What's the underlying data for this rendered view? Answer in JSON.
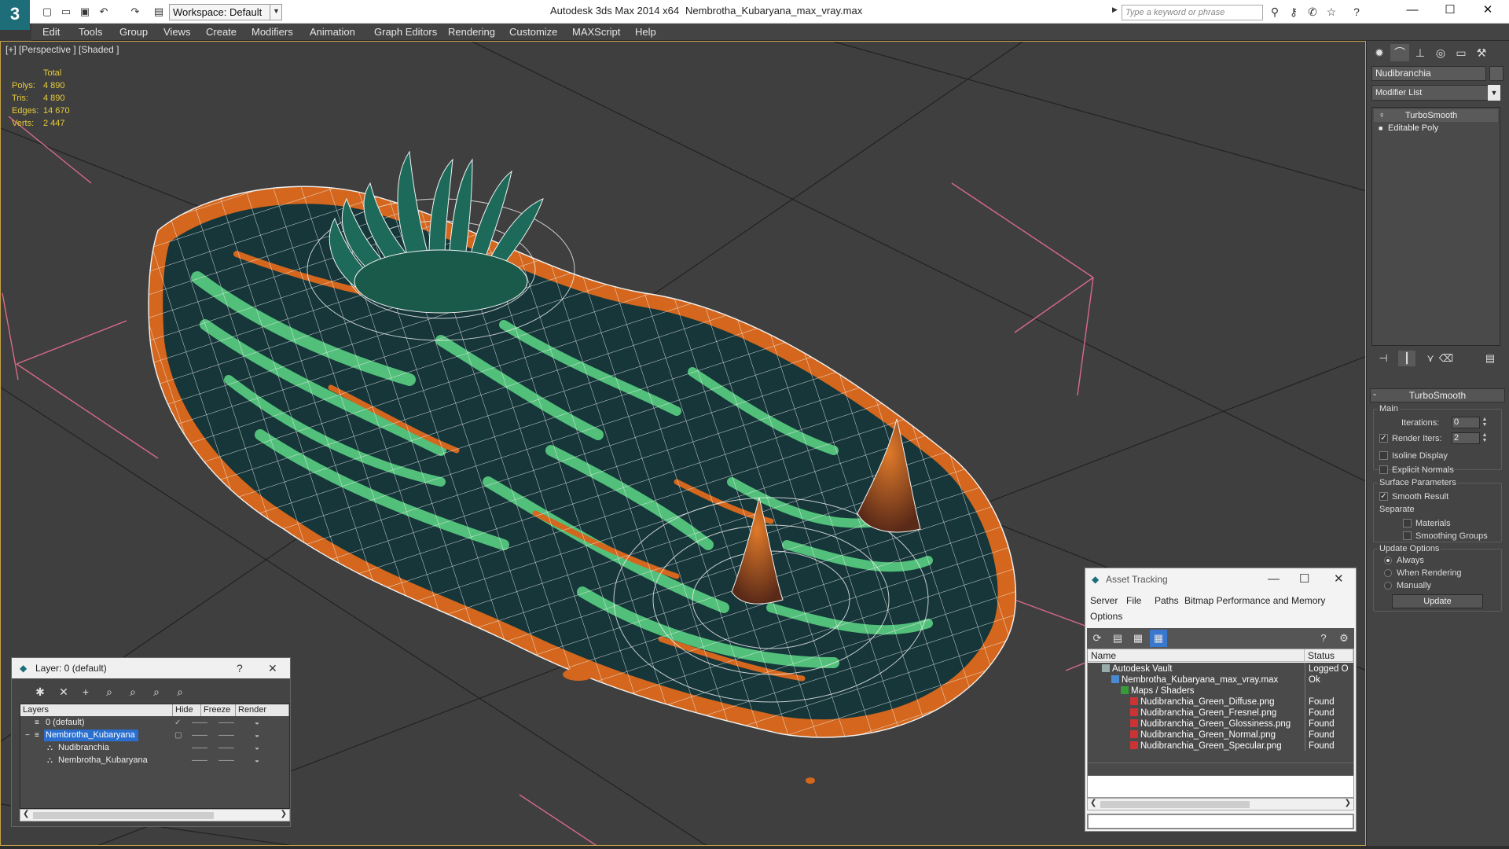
{
  "titlebar": {
    "app_title": "Autodesk 3ds Max  2014 x64",
    "file_title": "Nembrotha_Kubaryana_max_vray.max",
    "workspace": "Workspace: Default",
    "search_placeholder": "Type a keyword or phrase"
  },
  "menu": [
    "Edit",
    "Tools",
    "Group",
    "Views",
    "Create",
    "Modifiers",
    "Animation",
    "Graph Editors",
    "Rendering",
    "Customize",
    "MAXScript",
    "Help"
  ],
  "viewport": {
    "label": "[+] [Perspective ] [Shaded ]",
    "stats": {
      "header": "Total",
      "rows": [
        {
          "k": "Polys:",
          "v": "4 890"
        },
        {
          "k": "Tris:",
          "v": "4 890"
        },
        {
          "k": "Edges:",
          "v": "14 670"
        },
        {
          "k": "Verts:",
          "v": "2 447"
        }
      ]
    }
  },
  "command_panel": {
    "object_name": "Nudibranchia",
    "modifier_list": "Modifier List",
    "stack": [
      "TurboSmooth",
      "Editable Poly"
    ],
    "turbosmooth": {
      "title": "TurboSmooth",
      "main_label": "Main",
      "iterations_label": "Iterations:",
      "iterations": "0",
      "render_iters_label": "Render Iters:",
      "render_iters": "2",
      "isoline": "Isoline Display",
      "explicit": "Explicit Normals",
      "surface_label": "Surface Parameters",
      "smooth_result": "Smooth Result",
      "separate_label": "Separate",
      "materials": "Materials",
      "smoothing_groups": "Smoothing Groups",
      "update_label": "Update Options",
      "always": "Always",
      "when_rendering": "When Rendering",
      "manually": "Manually",
      "update_button": "Update"
    }
  },
  "layer_window": {
    "title": "Layer: 0 (default)",
    "help": "?",
    "columns": [
      "Layers",
      "Hide",
      "Freeze",
      "Render"
    ],
    "rows": [
      {
        "name": "0 (default)"
      },
      {
        "name": "Nembrotha_Kubaryana"
      },
      {
        "name": "Nudibranchia"
      },
      {
        "name": "Nembrotha_Kubaryana"
      }
    ]
  },
  "asset_window": {
    "title": "Asset Tracking",
    "menu": [
      "Server",
      "File",
      "Paths",
      "Bitmap Performance and Memory",
      "Options"
    ],
    "columns": [
      "Name",
      "Status"
    ],
    "rows": [
      {
        "name": "Autodesk Vault",
        "status": "Logged O"
      },
      {
        "name": "Nembrotha_Kubaryana_max_vray.max",
        "status": "Ok"
      },
      {
        "name": "Maps / Shaders",
        "status": ""
      },
      {
        "name": "Nudibranchia_Green_Diffuse.png",
        "status": "Found"
      },
      {
        "name": "Nudibranchia_Green_Fresnel.png",
        "status": "Found"
      },
      {
        "name": "Nudibranchia_Green_Glossiness.png",
        "status": "Found"
      },
      {
        "name": "Nudibranchia_Green_Normal.png",
        "status": "Found"
      },
      {
        "name": "Nudibranchia_Green_Specular.png",
        "status": "Found"
      }
    ]
  },
  "colors": {
    "viewport_bg": "#3f3f3f",
    "selection_blue": "#2a6fd0",
    "stats_yellow": "#e6cc3c",
    "model_orange": "#d4671d",
    "model_green": "#52c07a",
    "model_dark": "#16363a"
  }
}
